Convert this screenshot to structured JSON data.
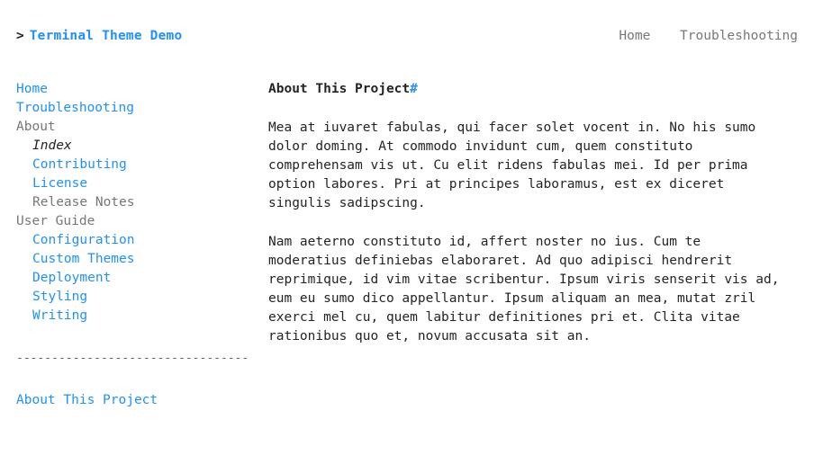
{
  "header": {
    "prompt": ">",
    "site_title": "Terminal Theme Demo",
    "nav": [
      {
        "label": "Home"
      },
      {
        "label": "Troubleshooting"
      }
    ]
  },
  "sidebar": {
    "items": [
      {
        "label": "Home",
        "level": 0,
        "style": "link"
      },
      {
        "label": "Troubleshooting",
        "level": 0,
        "style": "link"
      },
      {
        "label": "About",
        "level": 0,
        "style": "section"
      },
      {
        "label": "Index",
        "level": 1,
        "style": "current"
      },
      {
        "label": "Contributing",
        "level": 1,
        "style": "link"
      },
      {
        "label": "License",
        "level": 1,
        "style": "link"
      },
      {
        "label": "Release Notes",
        "level": 1,
        "style": "section"
      },
      {
        "label": "User Guide",
        "level": 0,
        "style": "section"
      },
      {
        "label": "Configuration",
        "level": 1,
        "style": "link"
      },
      {
        "label": "Custom Themes",
        "level": 1,
        "style": "link"
      },
      {
        "label": "Deployment",
        "level": 1,
        "style": "link"
      },
      {
        "label": "Styling",
        "level": 1,
        "style": "link"
      },
      {
        "label": "Writing",
        "level": 1,
        "style": "link"
      }
    ],
    "divider": "----------------------------------------",
    "toc_link": "About This Project"
  },
  "article": {
    "title": "About This Project",
    "anchor": "#",
    "paragraphs": [
      "Mea at iuvaret fabulas, qui facer solet vocent in. No his sumo dolor doming. At commodo invidunt cum, quem constituto comprehensam vis ut. Cu elit ridens fabulas mei. Id per prima option labores. Pri at principes laboramus, est ex diceret singulis sadipscing.",
      "Nam aeterno constituto id, affert noster no ius. Cum te moderatius definiebas elaboraret. Ad quo adipisci hendrerit reprimique, id vim vitae scribentur. Ipsum viris senserit vis ad, eum eu sumo dico appellantur. Ipsum aliquam an mea, mutat zril exerci mel cu, quem labitur definitiones pri et. Clita vitae rationibus quo et, novum accusata sit an."
    ]
  }
}
